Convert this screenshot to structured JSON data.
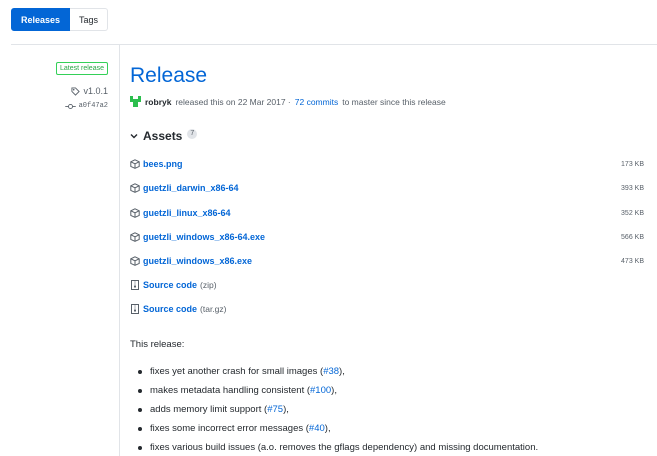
{
  "tabs": [
    {
      "label": "Releases"
    },
    {
      "label": "Tags"
    }
  ],
  "meta": {
    "badge": "Latest release",
    "tag": "v1.0.1",
    "commit": "a0f47a2"
  },
  "release": {
    "title": "Release",
    "author": "robryk",
    "released_text": "released this on 22 Mar 2017 ·",
    "commits_link": "72 commits",
    "since_text": "to master since this release"
  },
  "assets": {
    "heading": "Assets",
    "count": "7",
    "items": [
      {
        "name": "bees.png",
        "sub": "",
        "size": "173 KB",
        "icon": "package-icon"
      },
      {
        "name": "guetzli_darwin_x86-64",
        "sub": "",
        "size": "393 KB",
        "icon": "package-icon"
      },
      {
        "name": "guetzli_linux_x86-64",
        "sub": "",
        "size": "352 KB",
        "icon": "package-icon"
      },
      {
        "name": "guetzli_windows_x86-64.exe",
        "sub": "",
        "size": "566 KB",
        "icon": "package-icon"
      },
      {
        "name": "guetzli_windows_x86.exe",
        "sub": "",
        "size": "473 KB",
        "icon": "package-icon"
      },
      {
        "name": "Source code",
        "sub": "(zip)",
        "size": "",
        "icon": "file-zip-icon"
      },
      {
        "name": "Source code",
        "sub": "(tar.gz)",
        "size": "",
        "icon": "file-zip-icon"
      }
    ]
  },
  "notes": {
    "intro": "This release:",
    "items": [
      {
        "text": "fixes yet another crash for small images (",
        "link": "#38",
        "tail": "),"
      },
      {
        "text": "makes metadata handling consistent (",
        "link": "#100",
        "tail": "),"
      },
      {
        "text": "adds memory limit support (",
        "link": "#75",
        "tail": "),"
      },
      {
        "text": "fixes some incorrect error messages (",
        "link": "#40",
        "tail": "),"
      },
      {
        "text": "fixes various build issues (a.o. removes the gflags dependency) and missing documentation.",
        "link": "",
        "tail": ""
      }
    ]
  },
  "colors": {
    "link": "#0366d6",
    "badge_green": "#28a745",
    "avatar_green": "#2cbe4e"
  }
}
